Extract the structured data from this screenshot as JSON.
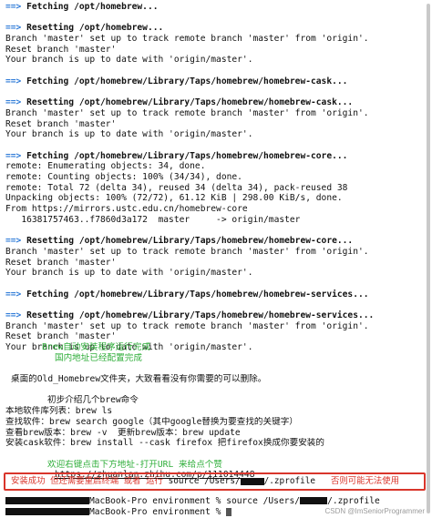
{
  "terminal": {
    "lines": [
      {
        "kind": "arrow",
        "text": "==> Fetching /opt/homebrew..."
      },
      {
        "kind": "blank"
      },
      {
        "kind": "arrow",
        "text": "==> Resetting /opt/homebrew..."
      },
      {
        "kind": "plain",
        "text": "Branch 'master' set up to track remote branch 'master' from 'origin'."
      },
      {
        "kind": "plain",
        "text": "Reset branch 'master'"
      },
      {
        "kind": "plain",
        "text": "Your branch is up to date with 'origin/master'."
      },
      {
        "kind": "blank"
      },
      {
        "kind": "arrow",
        "text": "==> Fetching /opt/homebrew/Library/Taps/homebrew/homebrew-cask..."
      },
      {
        "kind": "blank"
      },
      {
        "kind": "arrow",
        "text": "==> Resetting /opt/homebrew/Library/Taps/homebrew/homebrew-cask..."
      },
      {
        "kind": "plain",
        "text": "Branch 'master' set up to track remote branch 'master' from 'origin'."
      },
      {
        "kind": "plain",
        "text": "Reset branch 'master'"
      },
      {
        "kind": "plain",
        "text": "Your branch is up to date with 'origin/master'."
      },
      {
        "kind": "blank"
      },
      {
        "kind": "arrow",
        "text": "==> Fetching /opt/homebrew/Library/Taps/homebrew/homebrew-core..."
      },
      {
        "kind": "plain",
        "text": "remote: Enumerating objects: 34, done."
      },
      {
        "kind": "plain",
        "text": "remote: Counting objects: 100% (34/34), done."
      },
      {
        "kind": "plain",
        "text": "remote: Total 72 (delta 34), reused 34 (delta 34), pack-reused 38"
      },
      {
        "kind": "plain",
        "text": "Unpacking objects: 100% (72/72), 61.12 KiB | 298.00 KiB/s, done."
      },
      {
        "kind": "plain",
        "text": "From https://mirrors.ustc.edu.cn/homebrew-core"
      },
      {
        "kind": "plain",
        "text": "   16381757463..f7860d3a172  master     -> origin/master"
      },
      {
        "kind": "blank"
      },
      {
        "kind": "arrow",
        "text": "==> Resetting /opt/homebrew/Library/Taps/homebrew/homebrew-core..."
      },
      {
        "kind": "plain",
        "text": "Branch 'master' set up to track remote branch 'master' from 'origin'."
      },
      {
        "kind": "plain",
        "text": "Reset branch 'master'"
      },
      {
        "kind": "plain",
        "text": "Your branch is up to date with 'origin/master'."
      },
      {
        "kind": "blank"
      },
      {
        "kind": "arrow",
        "text": "==> Fetching /opt/homebrew/Library/Taps/homebrew/homebrew-services..."
      },
      {
        "kind": "blank"
      },
      {
        "kind": "arrow",
        "text": "==> Resetting /opt/homebrew/Library/Taps/homebrew/homebrew-services..."
      },
      {
        "kind": "plain",
        "text": "Branch 'master' set up to track remote branch 'master' from 'origin'."
      },
      {
        "kind": "plain",
        "text": "Reset branch 'master'"
      },
      {
        "kind": "plain",
        "text": "Your branch is up to date with 'origin/master'."
      }
    ],
    "install_done_1": "Brew自动安装程序运行完成",
    "install_done_2": "国内地址已经配置完成",
    "desktop_note": "桌面的Old_Homebrew文件夹，大致看看没有你需要的可以删除。",
    "intro_title": "初步介绍几个brew命令",
    "cmd_list": "本地软件库列表：brew ls",
    "cmd_search": "查找软件：brew search google（其中google替换为要查找的关键字）",
    "cmd_version": "查看brew版本：brew -v  更新brew版本：brew update",
    "cmd_cask": "安装cask软件：brew install --cask firefox 把firefox换成你要安装的",
    "welcome": "欢迎右键点击下方地址-打开URL 来给点个赞",
    "url": "https://zhuanlan.zhihu.com/p/111014448",
    "redbox_before": "安装成功 但还需要重启终端 或者 运行 ",
    "redbox_cmd": "source /Users/",
    "redbox_cmd_end": "/.zprofile",
    "redbox_after": "   否则可能无法使用",
    "prompt1_host": "MacBook-Pro environment % ",
    "prompt1_cmd": "source /Users/",
    "prompt1_end": "/.zprofile",
    "prompt2_host": "MacBook-Pro environment % ",
    "watermark": "CSDN @ImSeniorProgrammer"
  }
}
